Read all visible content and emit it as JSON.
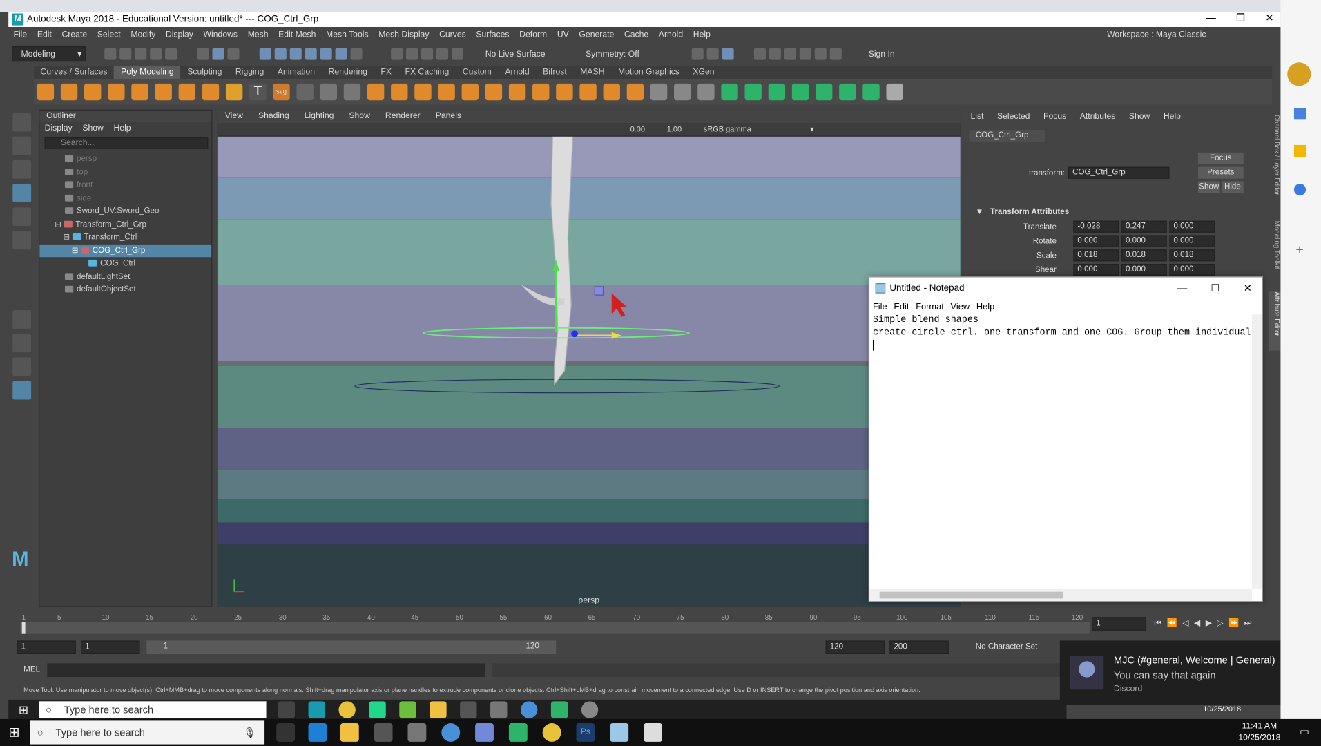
{
  "maya": {
    "title": "Autodesk Maya 2018 - Educational Version: untitled*   ---   COG_Ctrl_Grp",
    "menus": [
      "File",
      "Edit",
      "Create",
      "Select",
      "Modify",
      "Display",
      "Windows",
      "Mesh",
      "Edit Mesh",
      "Mesh Tools",
      "Mesh Display",
      "Curves",
      "Surfaces",
      "Deform",
      "UV",
      "Generate",
      "Cache",
      "Arnold",
      "Help"
    ],
    "workspace_label": "Workspace :",
    "workspace_value": "Maya Classic",
    "mode": "Modeling",
    "live_surface": "No Live Surface",
    "symmetry": "Symmetry: Off",
    "sign_in": "Sign In",
    "shelf_tabs": [
      "Curves / Surfaces",
      "Poly Modeling",
      "Sculpting",
      "Rigging",
      "Animation",
      "Rendering",
      "FX",
      "FX Caching",
      "Custom",
      "Arnold",
      "Bifrost",
      "MASH",
      "Motion Graphics",
      "XGen"
    ],
    "active_shelf_tab": "Poly Modeling",
    "outliner": {
      "title": "Outliner",
      "menu": [
        "Display",
        "Show",
        "Help"
      ],
      "search_placeholder": "Search...",
      "items": [
        {
          "label": "persp",
          "indent": 1
        },
        {
          "label": "top",
          "indent": 1
        },
        {
          "label": "front",
          "indent": 1
        },
        {
          "label": "side",
          "indent": 1
        },
        {
          "label": "Sword_UV:Sword_Geo",
          "indent": 1
        },
        {
          "label": "Transform_Ctrl_Grp",
          "indent": 1
        },
        {
          "label": "Transform_Ctrl",
          "indent": 2
        },
        {
          "label": "COG_Ctrl_Grp",
          "indent": 3
        },
        {
          "label": "COG_Ctrl",
          "indent": 4
        },
        {
          "label": "defaultLightSet",
          "indent": 1
        },
        {
          "label": "defaultObjectSet",
          "indent": 1
        }
      ]
    },
    "viewport": {
      "menu": [
        "View",
        "Shading",
        "Lighting",
        "Show",
        "Renderer",
        "Panels"
      ],
      "exposure": "0.00",
      "gamma": "1.00",
      "color_space": "sRGB gamma",
      "camera_label": "persp"
    },
    "attribute_editor": {
      "menu": [
        "List",
        "Selected",
        "Focus",
        "Attributes",
        "Show",
        "Help"
      ],
      "tab": "COG_Ctrl_Grp",
      "transform_label": "transform:",
      "transform_value": "COG_Ctrl_Grp",
      "buttons": [
        "Focus",
        "Presets",
        "Show",
        "Hide"
      ],
      "section": "Transform Attributes",
      "rows": [
        {
          "label": "Translate",
          "values": [
            "-0.028",
            "0.247",
            "0.000"
          ]
        },
        {
          "label": "Rotate",
          "values": [
            "0.000",
            "0.000",
            "0.000"
          ]
        },
        {
          "label": "Scale",
          "values": [
            "0.018",
            "0.018",
            "0.018"
          ]
        },
        {
          "label": "Shear",
          "values": [
            "0.000",
            "0.000",
            "0.000"
          ]
        }
      ],
      "side_tabs": [
        "Channel Box / Layer Editor",
        "Modeling Toolkit",
        "Attribute Editor"
      ]
    },
    "timeline": {
      "ticks": [
        "1",
        "5",
        "10",
        "15",
        "20",
        "25",
        "30",
        "35",
        "40",
        "45",
        "50",
        "55",
        "60",
        "65",
        "70",
        "75",
        "80",
        "85",
        "90",
        "95",
        "100",
        "105",
        "110",
        "115",
        "120"
      ],
      "current_frame": "1"
    },
    "range": {
      "start": "1",
      "playback_start": "1",
      "slider_start": "1",
      "slider_end": "120",
      "playback_end": "120",
      "end": "200",
      "character_set": "No Character Set"
    },
    "command_line_label": "MEL",
    "help_line": "Move Tool: Use manipulator to move object(s). Ctrl+MMB+drag to move components along normals. Shift+drag manipulator axis or plane handles to extrude components or clone objects. Ctrl+Shift+LMB+drag to constrain movement to a connected edge. Use D or INSERT to change the pivot position and axis orientation."
  },
  "notepad": {
    "title": "Untitled - Notepad",
    "menu": [
      "File",
      "Edit",
      "Format",
      "View",
      "Help"
    ],
    "line1": "Simple blend shapes",
    "line2": "create circle ctrl. one transform and one COG. Group them individual"
  },
  "toast": {
    "title": "MJC (#general, Welcome | General)",
    "message": "You can say that again",
    "app": "Discord"
  },
  "inner_taskbar": {
    "search_placeholder": "Type here to search",
    "date": "10/25/2018"
  },
  "taskbar": {
    "search_placeholder": "Type here to search",
    "time": "11:41 AM",
    "date": "10/25/2018"
  }
}
